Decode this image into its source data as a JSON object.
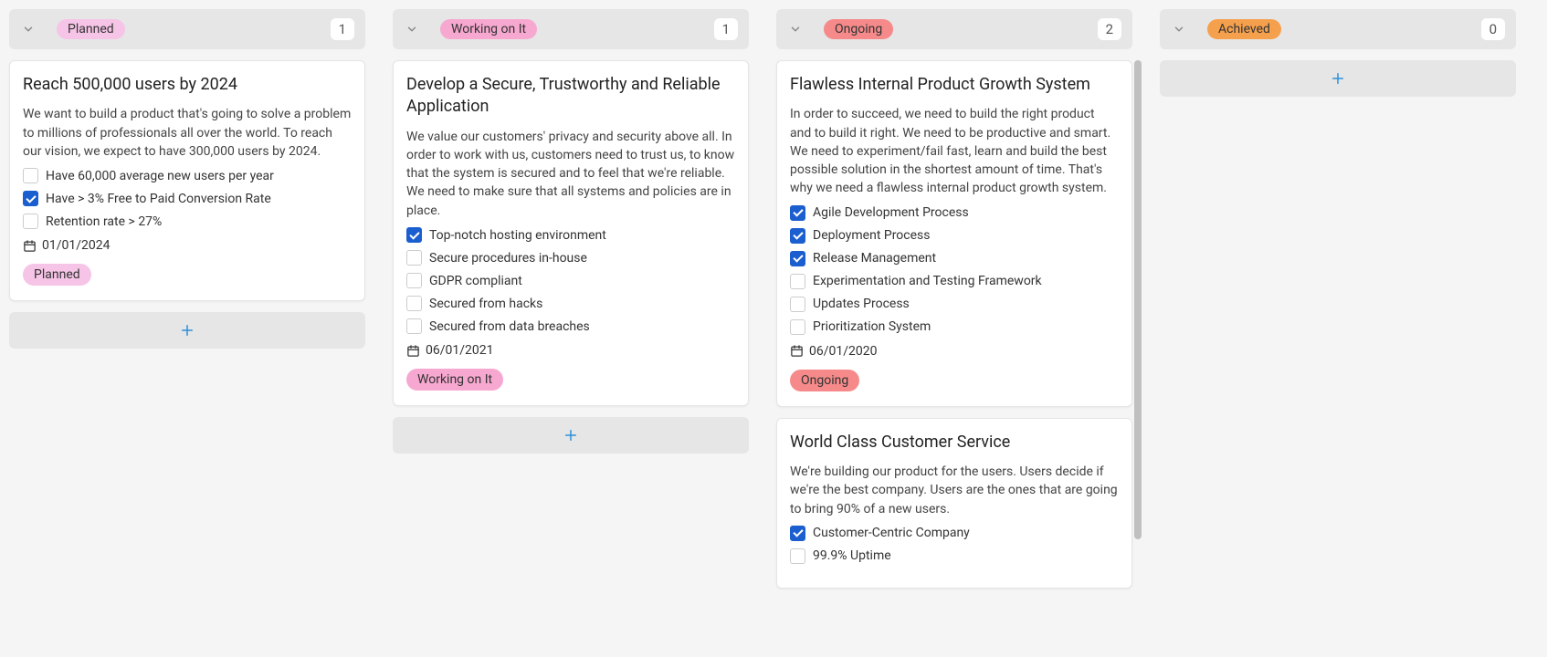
{
  "columns": [
    {
      "id": "planned",
      "status_label": "Planned",
      "pill_class": "pill-planned",
      "count": "1",
      "show_scrollbar": false,
      "cards": [
        {
          "title": "Reach 500,000 users by 2024",
          "description": "We want to build a product that's going to solve a problem to millions of professionals all over the world. To reach our vision, we expect to have 300,000 users by 2024.",
          "checklist": [
            {
              "label": "Have 60,000 average new users per year",
              "checked": false
            },
            {
              "label": "Have > 3% Free to Paid Conversion Rate",
              "checked": true
            },
            {
              "label": "Retention rate > 27%",
              "checked": false
            }
          ],
          "date": "01/01/2024",
          "status_label": "Planned",
          "status_class": "pill-planned"
        }
      ]
    },
    {
      "id": "working",
      "status_label": "Working on It",
      "pill_class": "pill-working",
      "count": "1",
      "show_scrollbar": false,
      "cards": [
        {
          "title": "Develop a Secure, Trustworthy and Reliable Application",
          "description": "We value our customers' privacy and security above all. In order to work with us, customers need to trust us, to know that the system is secured and to feel that we're reliable. We need to make sure that all systems and policies are in place.",
          "checklist": [
            {
              "label": "Top-notch hosting environment",
              "checked": true
            },
            {
              "label": "Secure procedures in-house",
              "checked": false
            },
            {
              "label": "GDPR compliant",
              "checked": false
            },
            {
              "label": "Secured from hacks",
              "checked": false
            },
            {
              "label": "Secured from data breaches",
              "checked": false
            }
          ],
          "date": "06/01/2021",
          "status_label": "Working on It",
          "status_class": "pill-working"
        }
      ]
    },
    {
      "id": "ongoing",
      "status_label": "Ongoing",
      "pill_class": "pill-ongoing",
      "count": "2",
      "show_scrollbar": true,
      "cards": [
        {
          "title": "Flawless Internal Product Growth System",
          "description": "In order to succeed, we need to build the right product and to build it right. We need to be productive and smart. We need to experiment/fail fast, learn and build the best possible solution in the shortest amount of time. That's why we need a flawless internal product growth system.",
          "checklist": [
            {
              "label": "Agile Development Process",
              "checked": true
            },
            {
              "label": "Deployment Process",
              "checked": true
            },
            {
              "label": "Release Management",
              "checked": true
            },
            {
              "label": "Experimentation and Testing Framework",
              "checked": false
            },
            {
              "label": "Updates Process",
              "checked": false
            },
            {
              "label": "Prioritization System",
              "checked": false
            }
          ],
          "date": "06/01/2020",
          "status_label": "Ongoing",
          "status_class": "pill-ongoing"
        },
        {
          "title": "World Class Customer Service",
          "description": "We're building our product for the users. Users decide if we're the best company. Users are the ones that are going to bring 90% of a new users.",
          "checklist": [
            {
              "label": "Customer-Centric Company",
              "checked": true
            },
            {
              "label": "99.9% Uptime",
              "checked": false
            }
          ],
          "date": "",
          "status_label": "",
          "status_class": ""
        }
      ]
    },
    {
      "id": "achieved",
      "status_label": "Achieved",
      "pill_class": "pill-achieved",
      "count": "0",
      "show_scrollbar": false,
      "cards": []
    }
  ]
}
